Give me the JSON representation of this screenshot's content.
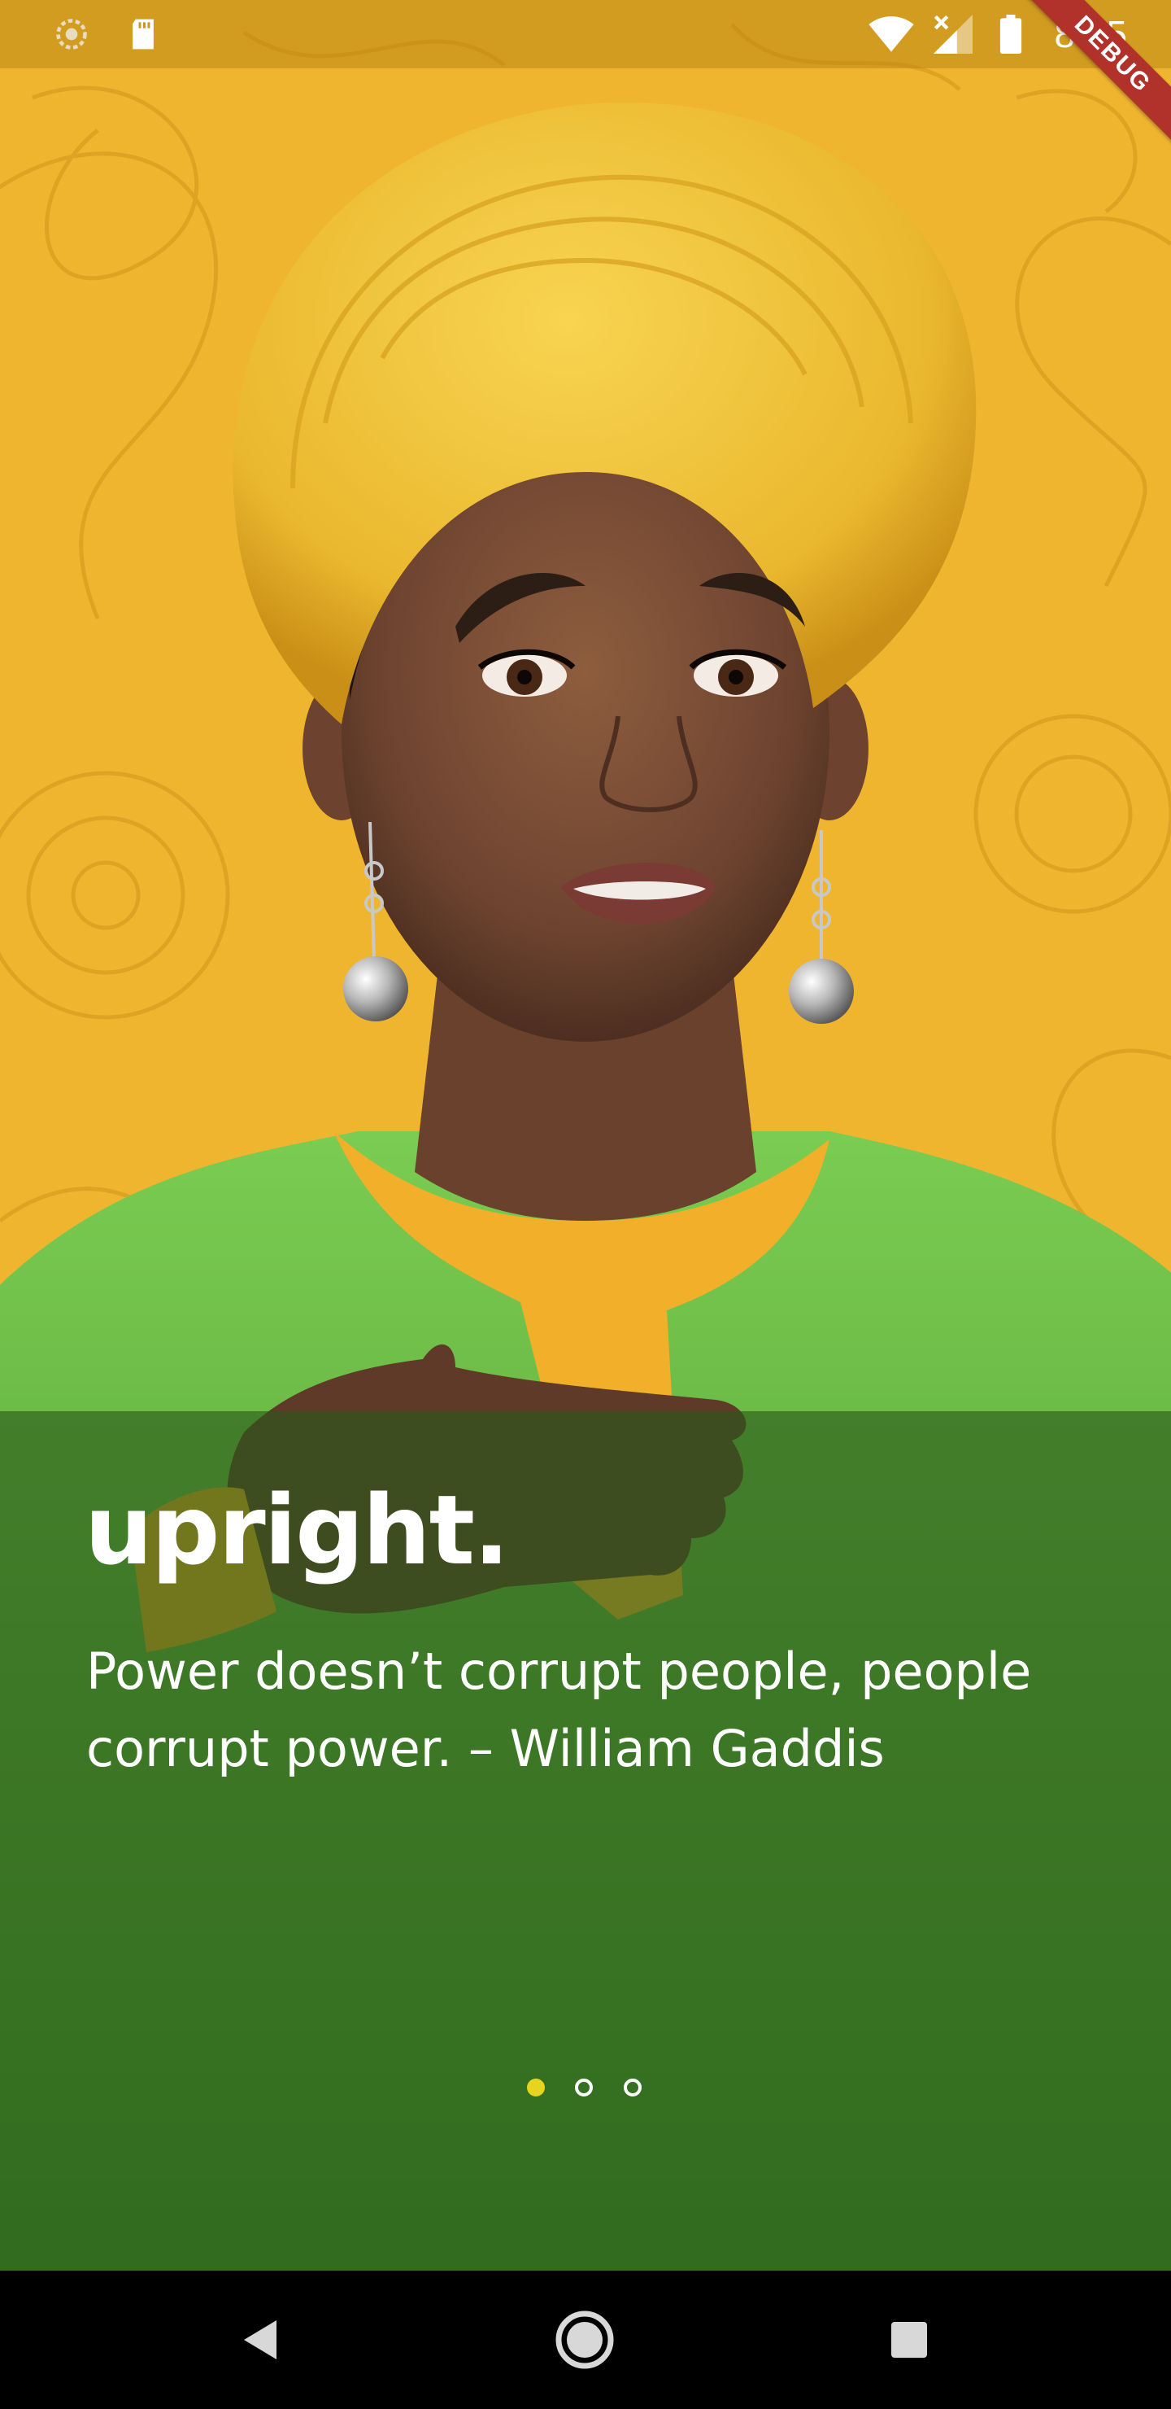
{
  "status_bar": {
    "time": "8:45",
    "left_icons": [
      "sync-icon",
      "sd-card-icon"
    ],
    "right_icons": [
      "wifi-icon",
      "cellular-signal-icon",
      "battery-icon"
    ]
  },
  "debug_banner": {
    "label": "DEBUG"
  },
  "slide": {
    "title": "upright.",
    "quote": "Power doesn’t corrupt people, people corrupt power. – William Gaddis"
  },
  "page_indicator": {
    "count": 3,
    "active_index": 0,
    "active_color": "#e6d421",
    "inactive_color": "#ffffff"
  },
  "nav_bar": {
    "buttons": [
      "back-icon",
      "home-icon",
      "recents-icon"
    ]
  },
  "colors": {
    "background": "#f0b52f",
    "overlay": "#2a581a",
    "headwrap": "#f4c53a",
    "shirt": "#6cc349",
    "collar": "#f2b02a"
  }
}
